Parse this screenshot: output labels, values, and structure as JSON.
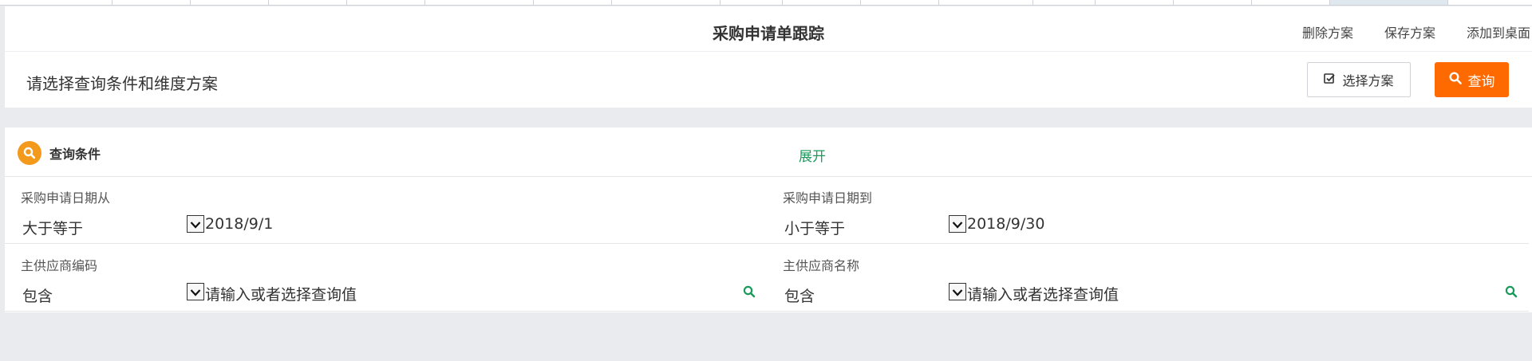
{
  "header": {
    "title": "采购申请单跟踪",
    "links": [
      "删除方案",
      "保存方案",
      "添加到桌面"
    ]
  },
  "scheme": {
    "prompt": "请选择查询条件和维度方案",
    "select_button": "选择方案",
    "query_button": "查询"
  },
  "panel": {
    "title": "查询条件",
    "expand": "展开"
  },
  "fields": [
    {
      "label": "采购申请日期从",
      "operator": "大于等于",
      "value": "2018/9/1"
    },
    {
      "label": "采购申请日期到",
      "operator": "小于等于",
      "value": "2018/9/30"
    },
    {
      "label": "主供应商编码",
      "operator": "包含",
      "placeholder": "请输入或者选择查询值"
    },
    {
      "label": "主供应商名称",
      "operator": "包含",
      "placeholder": "请输入或者选择查询值"
    }
  ],
  "colors": {
    "accent": "#ff6a00",
    "icon_circle": "#f39a1c",
    "link_green": "#1a9a5a"
  },
  "icons": [
    "check-square-icon",
    "search-icon",
    "chevron-down-icon"
  ]
}
